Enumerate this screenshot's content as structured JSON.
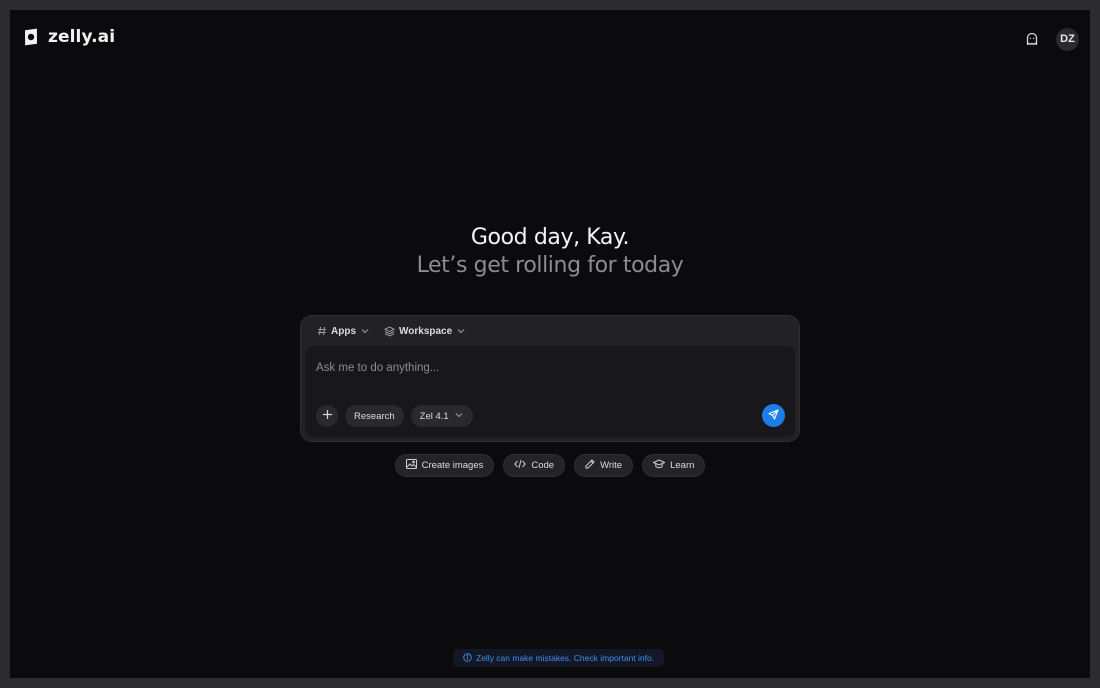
{
  "brand": {
    "name": "zelly.ai"
  },
  "header": {
    "avatar_initials": "DZ",
    "icons": [
      "ghost-icon"
    ]
  },
  "hero": {
    "greeting": "Good day, Kay.",
    "subtitle": "Let’s get rolling for today"
  },
  "composer": {
    "context_menus": [
      {
        "label": "Apps",
        "icon": "hash-icon"
      },
      {
        "label": "Workspace",
        "icon": "layers-icon"
      }
    ],
    "placeholder": "Ask me to do anything...",
    "research_label": "Research",
    "model_label": "Zel 4.1"
  },
  "suggestions": [
    {
      "label": "Create images",
      "icon": "image-icon"
    },
    {
      "label": "Code",
      "icon": "code-icon"
    },
    {
      "label": "Write",
      "icon": "pencil-icon"
    },
    {
      "label": "Learn",
      "icon": "graduation-cap-icon"
    }
  ],
  "footer": {
    "disclaimer": "Zelly can make mistakes. Check important info."
  },
  "colors": {
    "accent": "#1c7fe6",
    "background": "#0b0a0d",
    "disclaimer_text": "#3f8ff0"
  }
}
